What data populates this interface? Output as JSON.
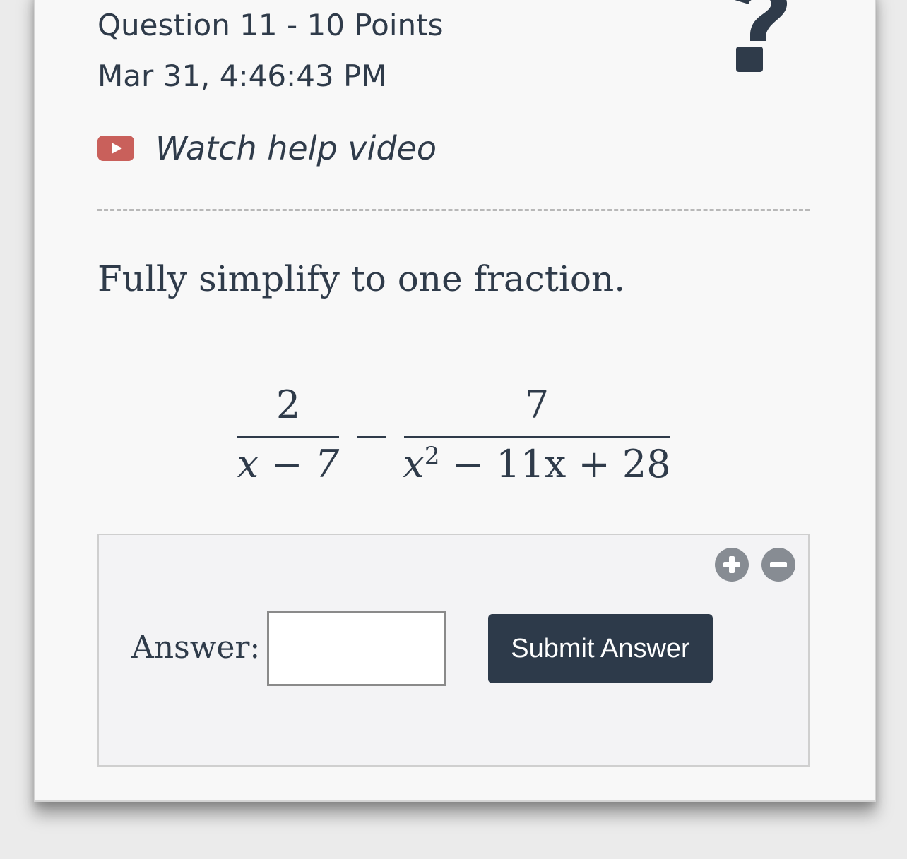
{
  "question": {
    "title": "Question 11 - 10 Points",
    "timestamp": "Mar 31, 4:46:43 PM"
  },
  "help_video": {
    "label": "Watch help video",
    "icon": "youtube-play-icon"
  },
  "help_icon": "question-mark-icon",
  "prompt": "Fully simplify to one fraction.",
  "expression": {
    "frac1": {
      "numerator": "2",
      "denominator": "x − 7"
    },
    "operator": "−",
    "frac2": {
      "numerator": "7",
      "denominator_base": "x",
      "denominator_exp": "2",
      "denominator_rest": " − 11x + 28"
    }
  },
  "answer": {
    "label": "Answer:",
    "value": "",
    "submit_label": "Submit Answer"
  },
  "zoom": {
    "in_icon": "plus-circle-icon",
    "out_icon": "minus-circle-icon"
  },
  "colors": {
    "text": "#2f3b4a",
    "video_icon": "#c9605b",
    "submit_bg": "#2d3a4a",
    "zoom_btn": "#878c93"
  }
}
